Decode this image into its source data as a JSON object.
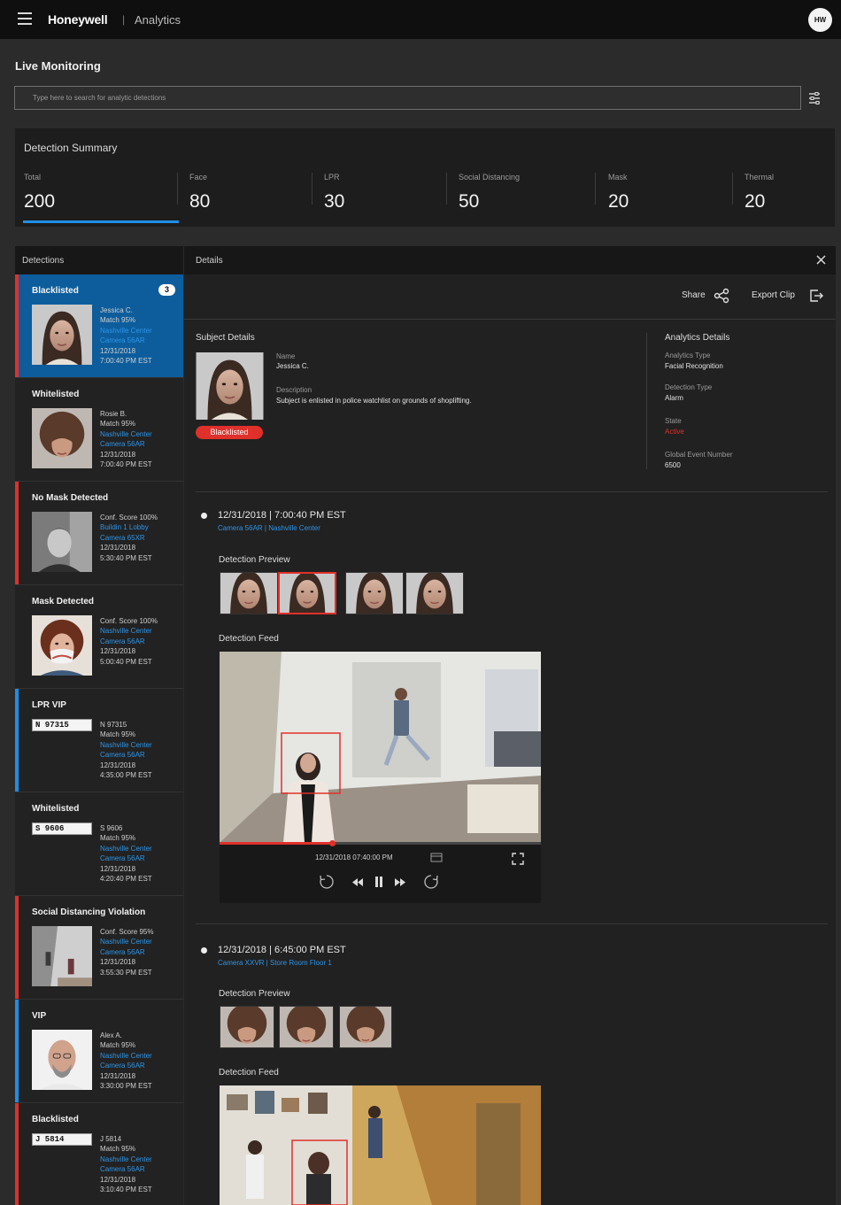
{
  "app": {
    "brand": "Honeywell",
    "separator": "|",
    "product": "Analytics",
    "user_initials": "HW"
  },
  "page": {
    "title": "Live Monitoring"
  },
  "search": {
    "placeholder": "Type here to search for analytic detections"
  },
  "summary": {
    "title": "Detection Summary",
    "stats": [
      {
        "label": "Total",
        "value": "200"
      },
      {
        "label": "Face",
        "value": "80"
      },
      {
        "label": "LPR",
        "value": "30"
      },
      {
        "label": "Social Distancing",
        "value": "50"
      },
      {
        "label": "Mask",
        "value": "20"
      },
      {
        "label": "Thermal",
        "value": "20"
      }
    ]
  },
  "detections": {
    "header": "Detections",
    "items": [
      {
        "title": "Blacklisted",
        "badge": "3",
        "status_color": "#e0302a",
        "lines": [
          "Jessica C.",
          "Match 95%"
        ],
        "location": "Nashville Center",
        "camera": "Camera 56AR",
        "date": "12/31/2018",
        "time": "7:00:40 PM EST"
      },
      {
        "title": "Whitelisted",
        "status_color": "#222222",
        "lines": [
          "Rosie B.",
          "Match 95%"
        ],
        "location": "Nashville Center",
        "camera": "Camera 56AR",
        "date": "12/31/2018",
        "time": "7:00:40 PM EST"
      },
      {
        "title": "No Mask Detected",
        "status_color": "#e0302a",
        "lines": [
          "Conf. Score 100%"
        ],
        "location": "Buildin 1 Lobby",
        "camera": "Camera 65XR",
        "date": "12/31/2018",
        "time": "5:30:40 PM EST"
      },
      {
        "title": "Mask Detected",
        "status_color": "#222222",
        "lines": [
          "Conf. Score 100%"
        ],
        "location": "Nashville Center",
        "camera": "Camera 56AR",
        "date": "12/31/2018",
        "time": "5:00:40 PM EST"
      },
      {
        "title": "LPR VIP",
        "status_color": "#1f8ee6",
        "plate": "N 97315",
        "lines": [
          "N 97315",
          "Match 95%"
        ],
        "location": "Nashville Center",
        "camera": "Camera 56AR",
        "date": "12/31/2018",
        "time": "4:35:00 PM EST"
      },
      {
        "title": "Whitelisted",
        "status_color": "#222222",
        "plate": "S 9606",
        "lines": [
          "S 9606",
          "Match 95%"
        ],
        "location": "Nashville Center",
        "camera": "Camera 56AR",
        "date": "12/31/2018",
        "time": "4:20:40 PM EST"
      },
      {
        "title": "Social Distancing Violation",
        "status_color": "#e0302a",
        "lines": [
          "Conf. Score 95%"
        ],
        "location": "Nashville Center",
        "camera": "Camera 56AR",
        "date": "12/31/2018",
        "time": "3:55:30 PM EST"
      },
      {
        "title": "VIP",
        "status_color": "#1f8ee6",
        "lines": [
          "Alex A.",
          "Match 95%"
        ],
        "location": "Nashville Center",
        "camera": "Camera 56AR",
        "date": "12/31/2018",
        "time": "3:30:00 PM EST"
      },
      {
        "title": "Blacklisted",
        "status_color": "#e0302a",
        "plate": "J 5814",
        "lines": [
          "J 5814",
          "Match 95%"
        ],
        "location": "Nashville Center",
        "camera": "Camera 56AR",
        "date": "12/31/2018",
        "time": "3:10:40 PM EST"
      }
    ]
  },
  "details": {
    "header": "Details",
    "share_label": "Share",
    "export_label": "Export Clip",
    "subject": {
      "section_title": "Subject Details",
      "name_label": "Name",
      "name": "Jessica C.",
      "description_label": "Description",
      "description": "Subject is enlisted in police watchlist on grounds of shoplifting.",
      "status_pill": "Blacklisted"
    },
    "analytics": {
      "section_title": "Analytics Details",
      "type_label": "Analytics Type",
      "type": "Facial Recognition",
      "detection_type_label": "Detection Type",
      "detection_type": "Alarm",
      "state_label": "State",
      "state": "Active",
      "event_number_label": "Global Event Number",
      "event_number": "6500"
    },
    "events": [
      {
        "timestamp": "12/31/2018 | 7:00:40 PM EST",
        "camera": "Camera 56AR | Nashville Center",
        "preview_label": "Detection Preview",
        "feed_label": "Detection Feed",
        "player_time": "12/31/2018 07:40:00 PM",
        "progress": 0.35
      },
      {
        "timestamp": "12/31/2018 | 6:45:00 PM EST",
        "camera": "Camera XXVR | Store Room Floor 1",
        "preview_label": "Detection Preview",
        "feed_label": "Detection Feed"
      }
    ]
  }
}
